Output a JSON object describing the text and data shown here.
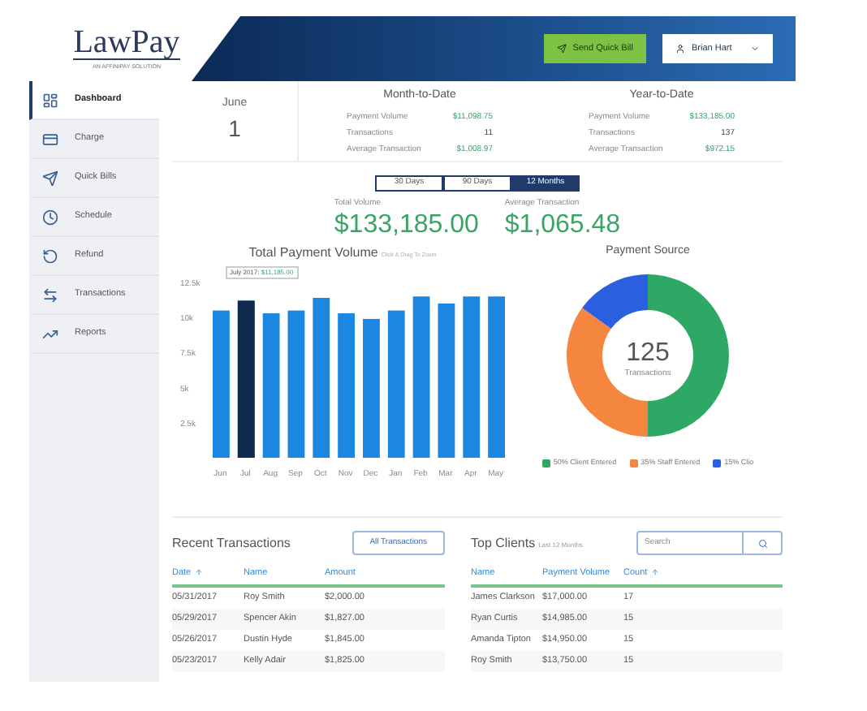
{
  "header": {
    "logo": "LawPay",
    "logo_tagline": "AN AFFINIPAY SOLUTION",
    "send_button": "Send Quick Bill",
    "user": "Brian Hart"
  },
  "sidebar": {
    "items": [
      {
        "label": "Dashboard",
        "selected": true,
        "kind": "dashboard"
      },
      {
        "label": "Charge",
        "selected": false,
        "kind": "charge"
      },
      {
        "label": "Quick Bills",
        "selected": false,
        "kind": "quickbills"
      },
      {
        "label": "Schedule",
        "selected": false,
        "kind": "schedule"
      },
      {
        "label": "Refund",
        "selected": false,
        "kind": "refund"
      },
      {
        "label": "Transactions",
        "selected": false,
        "kind": "transactions"
      },
      {
        "label": "Reports",
        "selected": false,
        "kind": "reports"
      }
    ]
  },
  "date": {
    "month": "June",
    "day": "1"
  },
  "summaries": [
    {
      "title": "Month-to-Date",
      "rows": [
        {
          "label": "Payment Volume",
          "value": "$11,098.75",
          "green": true
        },
        {
          "label": "Transactions",
          "value": "11",
          "green": false
        },
        {
          "label": "Average Transaction",
          "value": "$1,008.97",
          "green": true
        }
      ]
    },
    {
      "title": "Year-to-Date",
      "rows": [
        {
          "label": "Payment Volume",
          "value": "$133,185.00",
          "green": true
        },
        {
          "label": "Transactions",
          "value": "137",
          "green": false
        },
        {
          "label": "Average Transaction",
          "value": "$972.15",
          "green": true
        }
      ]
    }
  ],
  "ranges": [
    {
      "label": "30 Days",
      "selected": false
    },
    {
      "label": "90 Days",
      "selected": false
    },
    {
      "label": "12 Months",
      "selected": true
    }
  ],
  "totals": [
    {
      "label": "Total Volume",
      "value": "$133,185.00"
    },
    {
      "label": "Average Transaction",
      "value": "$1,065.48"
    }
  ],
  "volume_chart": {
    "hint": "Click & Drag To Zoom",
    "tooltip": {
      "label": "July 2017:",
      "value": "$11,185.00"
    },
    "highlighted": [
      false,
      true,
      false,
      false,
      false,
      false,
      false,
      false,
      false,
      false,
      false,
      false
    ],
    "chart_data": {
      "type": "bar",
      "title": "Total Payment Volume",
      "categories": [
        "Jun",
        "Jul",
        "Aug",
        "Sep",
        "Oct",
        "Nov",
        "Dec",
        "Jan",
        "Feb",
        "Mar",
        "Apr",
        "May"
      ],
      "series": [
        {
          "color": "#1b87e0",
          "values": [
            10500,
            11200,
            10300,
            10500,
            11400,
            10300,
            9900,
            10500,
            11500,
            11000,
            11500,
            11500
          ]
        }
      ],
      "ylim": [
        0,
        12500
      ],
      "yticks": [
        {
          "value": 2500,
          "label": "2.5k"
        },
        {
          "value": 5000,
          "label": "5k"
        },
        {
          "value": 7500,
          "label": "7.5k"
        },
        {
          "value": 10000,
          "label": "10k"
        },
        {
          "value": 12500,
          "label": "12.5k"
        }
      ]
    }
  },
  "source_chart": {
    "center_value": "125",
    "center_label": "Transactions",
    "chart_data": {
      "type": "donut",
      "title": "Payment Source",
      "categories": [
        "50% Client Entered",
        "35% Staff Entered",
        "15% Clio"
      ],
      "series": [
        {
          "values": [
            50,
            35,
            15
          ]
        }
      ],
      "colors": [
        "#2ea865",
        "#f5863f",
        "#2a5fe0"
      ]
    }
  },
  "recent": {
    "title": "Recent Transactions",
    "button": "All Transactions",
    "columns": [
      {
        "label": "Date",
        "sorted": true
      },
      {
        "label": "Name",
        "sorted": false
      },
      {
        "label": "Amount",
        "sorted": false
      }
    ],
    "rows": [
      [
        "05/31/2017",
        "Roy Smith",
        "$2,000.00"
      ],
      [
        "05/29/2017",
        "Spencer Akin",
        "$1,827.00"
      ],
      [
        "05/26/2017",
        "Dustin Hyde",
        "$1,845.00"
      ],
      [
        "05/23/2017",
        "Kelly Adair",
        "$1,825.00"
      ]
    ]
  },
  "top_clients": {
    "title": "Top Clients",
    "subtitle": "Last 12 Months",
    "search_placeholder": "Search",
    "columns": [
      {
        "label": "Name",
        "sorted": false
      },
      {
        "label": "Payment Volume",
        "sorted": false
      },
      {
        "label": "Count",
        "sorted": true
      }
    ],
    "rows": [
      [
        "James Clarkson",
        "$17,000.00",
        "17"
      ],
      [
        "Ryan Curtis",
        "$14,985.00",
        "15"
      ],
      [
        "Amanda Tipton",
        "$14,950.00",
        "15"
      ],
      [
        "Roy Smith",
        "$13,750.00",
        "15"
      ]
    ]
  }
}
